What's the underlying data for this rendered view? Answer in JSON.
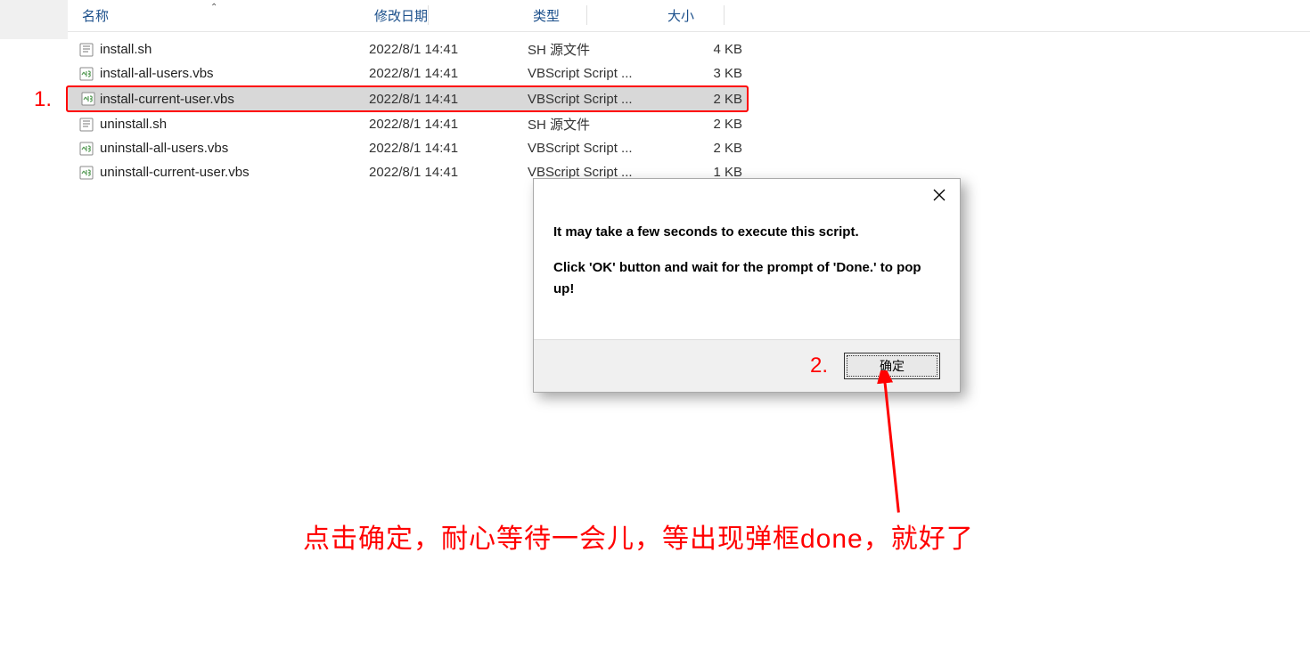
{
  "headers": {
    "name": "名称",
    "date": "修改日期",
    "type": "类型",
    "size": "大小"
  },
  "files": [
    {
      "name": "install.sh",
      "date": "2022/8/1 14:41",
      "type": "SH 源文件",
      "size": "4 KB",
      "icon": "sh"
    },
    {
      "name": "install-all-users.vbs",
      "date": "2022/8/1 14:41",
      "type": "VBScript Script ...",
      "size": "3 KB",
      "icon": "vbs"
    },
    {
      "name": "install-current-user.vbs",
      "date": "2022/8/1 14:41",
      "type": "VBScript Script ...",
      "size": "2 KB",
      "icon": "vbs",
      "selected": true
    },
    {
      "name": "uninstall.sh",
      "date": "2022/8/1 14:41",
      "type": "SH 源文件",
      "size": "2 KB",
      "icon": "sh"
    },
    {
      "name": "uninstall-all-users.vbs",
      "date": "2022/8/1 14:41",
      "type": "VBScript Script ...",
      "size": "2 KB",
      "icon": "vbs"
    },
    {
      "name": "uninstall-current-user.vbs",
      "date": "2022/8/1 14:41",
      "type": "VBScript Script ...",
      "size": "1 KB",
      "icon": "vbs"
    }
  ],
  "dialog": {
    "line1": "It may take a few seconds to execute this script.",
    "line2": "Click 'OK' button and wait for the prompt of 'Done.' to pop up!",
    "ok_label": "确定"
  },
  "annotations": {
    "step1": "1.",
    "step2": "2.",
    "bottom": "点击确定，耐心等待一会儿，等出现弹框done，就好了"
  }
}
